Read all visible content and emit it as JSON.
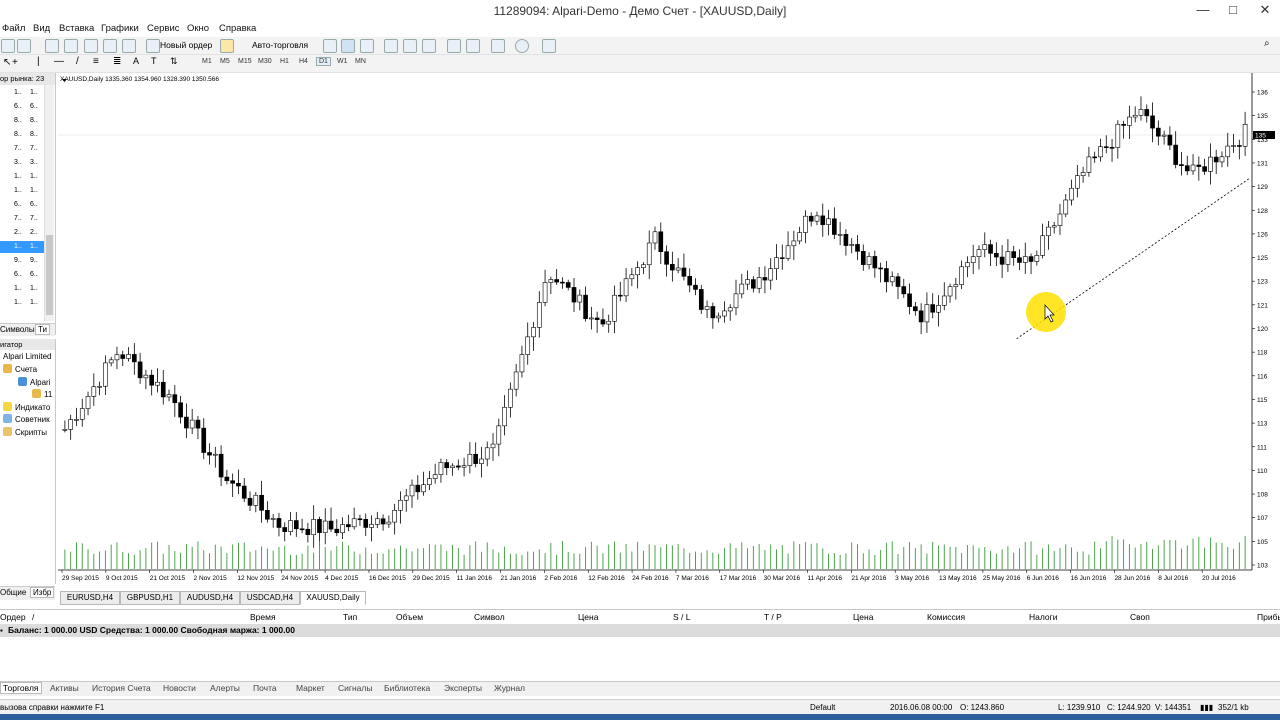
{
  "window": {
    "title": "11289094: Alpari-Demo - Демо Счет - [XAUUSD,Daily]",
    "minimize": "—",
    "maximize": "□",
    "close": "✕"
  },
  "menu": [
    "Файл",
    "Вид",
    "Вставка",
    "Графики",
    "Сервис",
    "Окно",
    "Справка"
  ],
  "toolbar": {
    "new_order": "Новый ордер",
    "auto_trading": "Авто-торговля",
    "timeframes": [
      "M1",
      "M5",
      "M15",
      "M30",
      "H1",
      "H4",
      "D1",
      "W1",
      "MN"
    ],
    "active_timeframe": "D1"
  },
  "market_watch": {
    "header": "ор рынка: 23",
    "rows": [
      [
        "1..",
        "1.."
      ],
      [
        "6..",
        "6.."
      ],
      [
        "8..",
        "8.."
      ],
      [
        "8..",
        "8.."
      ],
      [
        "7..",
        "7.."
      ],
      [
        "3..",
        "3.."
      ],
      [
        "1..",
        "1.."
      ],
      [
        "1..",
        "1.."
      ],
      [
        "6..",
        "6.."
      ],
      [
        "7..",
        "7.."
      ],
      [
        "2..",
        "2.."
      ],
      [
        "1..",
        "1.."
      ],
      [
        "9..",
        "9.."
      ],
      [
        "6..",
        "6.."
      ],
      [
        "1..",
        "1.."
      ],
      [
        "1..",
        "1.."
      ]
    ],
    "selected_row": 11,
    "tabs": [
      "Символы",
      "Ти"
    ]
  },
  "navigator": {
    "header": "игатор",
    "items": [
      {
        "label": "Alpari Limited",
        "indent": 0
      },
      {
        "label": "Счета",
        "indent": 1
      },
      {
        "label": "Alpari",
        "indent": 2
      },
      {
        "label": "11",
        "indent": 3
      },
      {
        "label": "Индикато",
        "indent": 1
      },
      {
        "label": "Советник",
        "indent": 1
      },
      {
        "label": "Скрипты",
        "indent": 1
      }
    ],
    "tabs": [
      "Общие",
      "Избр"
    ]
  },
  "chart_data": {
    "type": "candlestick",
    "symbol_line": "XAUUSD,Daily  1335.360 1354.960 1328.390 1350.566",
    "x_ticks": [
      "29 Sep 2015",
      "9 Oct 2015",
      "21 Oct 2015",
      "2 Nov 2015",
      "12 Nov 2015",
      "24 Nov 2015",
      "4 Dec 2015",
      "16 Dec 2015",
      "29 Dec 2015",
      "11 Jan 2016",
      "21 Jan 2016",
      "2 Feb 2016",
      "12 Feb 2016",
      "24 Feb 2016",
      "7 Mar 2016",
      "17 Mar 2016",
      "30 Mar 2016",
      "11 Apr 2016",
      "21 Apr 2016",
      "3 May 2016",
      "13 May 2016",
      "25 May 2016",
      "6 Jun 2016",
      "16 Jun 2016",
      "28 Jun 2016",
      "8 Jul 2016",
      "20 Jul 2016"
    ],
    "y_ticks": [
      "136",
      "135",
      "133",
      "131",
      "129",
      "128",
      "126",
      "125",
      "123",
      "121",
      "120",
      "118",
      "116",
      "115",
      "113",
      "111",
      "110",
      "108",
      "107",
      "105",
      "103"
    ],
    "current_price_label": "135",
    "approx_close_path": [
      {
        "date": "29 Sep 2015",
        "close": 1127
      },
      {
        "date": "15 Oct 2015",
        "close": 1186
      },
      {
        "date": "28 Oct 2015",
        "close": 1150
      },
      {
        "date": "6 Nov 2015",
        "close": 1090
      },
      {
        "date": "3 Dec 2015",
        "close": 1055
      },
      {
        "date": "17 Dec 2015",
        "close": 1052
      },
      {
        "date": "31 Dec 2015",
        "close": 1062
      },
      {
        "date": "8 Jan 2016",
        "close": 1097
      },
      {
        "date": "26 Jan 2016",
        "close": 1111
      },
      {
        "date": "11 Feb 2016",
        "close": 1246
      },
      {
        "date": "16 Feb 2016",
        "close": 1205
      },
      {
        "date": "10 Mar 2016",
        "close": 1270
      },
      {
        "date": "29 Mar 2016",
        "close": 1213
      },
      {
        "date": "22 Apr 2016",
        "close": 1243
      },
      {
        "date": "2 May 2016",
        "close": 1293
      },
      {
        "date": "20 May 2016",
        "close": 1253
      },
      {
        "date": "31 May 2016",
        "close": 1212
      },
      {
        "date": "8 Jun 2016",
        "close": 1262
      },
      {
        "date": "20 Jun 2016",
        "close": 1250
      },
      {
        "date": "24 Jun 2016",
        "close": 1321
      },
      {
        "date": "6 Jul 2016",
        "close": 1367
      },
      {
        "date": "21 Jul 2016",
        "close": 1318
      },
      {
        "date": "29 Jul 2016",
        "close": 1350
      }
    ],
    "trendline": "dashed ascending from 25 May 2016 to end",
    "volume": "green histogram along bottom",
    "grid": false
  },
  "chart_tabs": [
    "EURUSD,H4",
    "GBPUSD,H1",
    "AUDUSD,H4",
    "USDCAD,H4",
    "XAUUSD,Daily"
  ],
  "active_chart_tab": 4,
  "terminal": {
    "columns": [
      "Ордер",
      "/",
      "Время",
      "Тип",
      "Объем",
      "Символ",
      "Цена",
      "S / L",
      "T / P",
      "Цена",
      "Комиссия",
      "Налоги",
      "Своп",
      "Прибы"
    ],
    "balance_line": "Баланс: 1 000.00 USD  Средства: 1 000.00  Свободная маржа: 1 000.00",
    "tabs": [
      "Торговля",
      "Активы",
      "История Счета",
      "Новости",
      "Алерты",
      "Почта",
      "Маркет",
      "Сигналы",
      "Библиотека",
      "Эксперты",
      "Журнал"
    ],
    "active_tab": 0
  },
  "status": {
    "help": "вызова справки нажмите F1",
    "profile": "Default",
    "datetime": "2016.06.08 00:00",
    "open": "O: 1243.860",
    "low": "L: 1239.910",
    "close": "C: 1244.920",
    "volume": "V: 144351",
    "traffic": "352/1 kb"
  },
  "colors": {
    "bull": "#ffffff",
    "bear": "#000000",
    "volume": "#3a9a3a",
    "selection": "#3399ff",
    "highlight": "#ffe100"
  }
}
